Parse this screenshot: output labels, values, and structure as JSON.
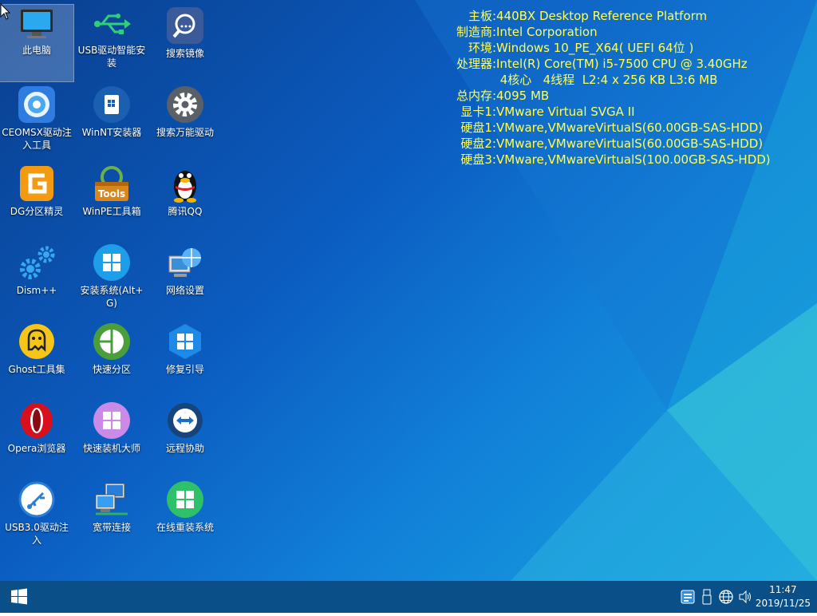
{
  "desktop": {
    "icons": [
      {
        "label": "此电脑",
        "icon": "computer-icon"
      },
      {
        "label": "USB驱动智能安装",
        "icon": "usb-icon"
      },
      {
        "label": "搜索镜像",
        "icon": "search-icon"
      },
      {
        "label": "CEOMSX驱动注入工具",
        "icon": "ceomsx-icon"
      },
      {
        "label": "WinNT安装器",
        "icon": "winnt-icon"
      },
      {
        "label": "搜索万能驱动",
        "icon": "gear-icon"
      },
      {
        "label": "DG分区精灵",
        "icon": "diskgenius-icon"
      },
      {
        "label": "WinPE工具箱",
        "icon": "toolbox-icon"
      },
      {
        "label": "腾讯QQ",
        "icon": "qq-penguin-icon"
      },
      {
        "label": "Dism++",
        "icon": "dism-gears-icon"
      },
      {
        "label": "安装系统(Alt+G)",
        "icon": "windows-install-icon"
      },
      {
        "label": "网络设置",
        "icon": "network-globe-icon"
      },
      {
        "label": "Ghost工具集",
        "icon": "ghost-icon"
      },
      {
        "label": "快速分区",
        "icon": "partition-pie-icon"
      },
      {
        "label": "修复引导",
        "icon": "boot-repair-icon"
      },
      {
        "label": "Opera浏览器",
        "icon": "opera-icon"
      },
      {
        "label": "快速装机大师",
        "icon": "quick-install-icon"
      },
      {
        "label": "远程协助",
        "icon": "teamviewer-icon"
      },
      {
        "label": "USB3.0驱动注入",
        "icon": "usb3-icon"
      },
      {
        "label": "宽带连接",
        "icon": "broadband-icon"
      },
      {
        "label": "在线重装系统",
        "icon": "online-reinstall-icon"
      }
    ],
    "sysinfo": [
      {
        "key": "主板:",
        "value": "440BX Desktop Reference Platform"
      },
      {
        "key": "制造商:",
        "value": "Intel Corporation"
      },
      {
        "key": "环境:",
        "value": "Windows 10_PE_X64( UEFI 64位 )"
      },
      {
        "key": "处理器:",
        "value": "Intel(R) Core(TM) i5-7500 CPU @ 3.40GHz"
      },
      {
        "key": "",
        "value": " 4核心   4线程  L2:4 x 256 KB L3:6 MB"
      },
      {
        "key": "总内存:",
        "value": "4095 MB"
      },
      {
        "key": "显卡1:",
        "value": "VMware Virtual SVGA II"
      },
      {
        "key": "硬盘1:",
        "value": "VMware,VMwareVirtualS(60.00GB-SAS-HDD)"
      },
      {
        "key": "硬盘2:",
        "value": "VMware,VMwareVirtualS(60.00GB-SAS-HDD)"
      },
      {
        "key": "硬盘3:",
        "value": "VMware,VMwareVirtualS(100.00GB-SAS-HDD)"
      }
    ],
    "info_color": "#ffff55"
  },
  "taskbar": {
    "start_icon": "windows-logo-icon",
    "tray_icons": [
      "input-method-icon",
      "usb-device-icon",
      "network-globe-icon",
      "volume-icon"
    ],
    "clock": {
      "time": "11:47",
      "date": "2019/11/25"
    }
  }
}
